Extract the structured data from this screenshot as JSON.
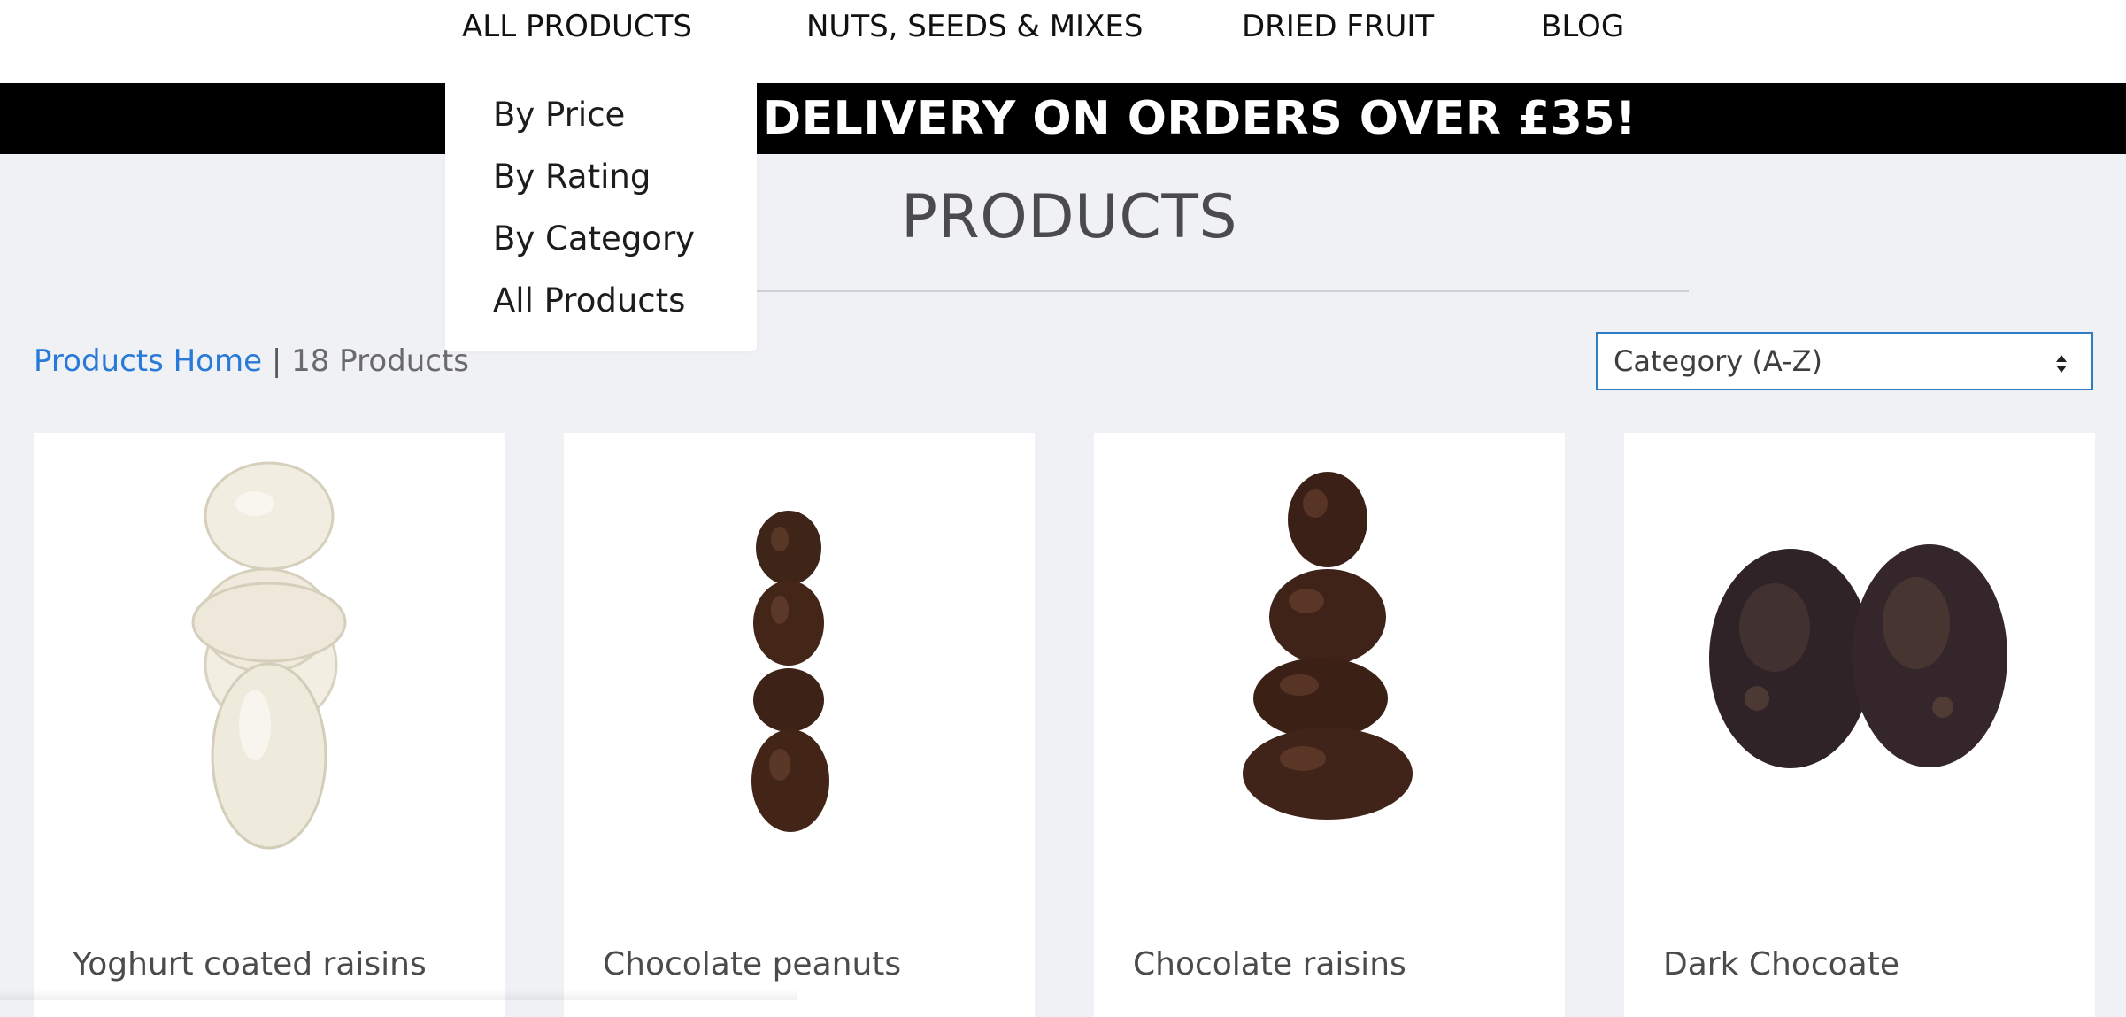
{
  "nav": {
    "items": [
      {
        "label": "ALL PRODUCTS"
      },
      {
        "label": "NUTS, SEEDS & MIXES"
      },
      {
        "label": "DRIED FRUIT"
      },
      {
        "label": "BLOG"
      }
    ]
  },
  "dropdown": {
    "items": [
      {
        "label": "By Price"
      },
      {
        "label": "By Rating"
      },
      {
        "label": "By Category"
      },
      {
        "label": "All Products"
      }
    ]
  },
  "banner": {
    "text": "DELIVERY ON ORDERS OVER £35!"
  },
  "page": {
    "title": "PRODUCTS"
  },
  "breadcrumb": {
    "home": "Products Home",
    "separator": " | ",
    "count": "18 Products"
  },
  "sort": {
    "selected": "Category (A-Z)"
  },
  "products": [
    {
      "name": "Yoghurt coated raisins",
      "image": "yoghurt-raisins"
    },
    {
      "name": "Chocolate peanuts",
      "image": "chocolate-peanuts"
    },
    {
      "name": "Chocolate raisins",
      "image": "chocolate-raisins"
    },
    {
      "name": "Dark Chocoate",
      "image": "dark-chocolate"
    }
  ],
  "colors": {
    "accent": "#2979d9",
    "banner_bg": "#000000",
    "page_bg": "#f0f1f5"
  }
}
